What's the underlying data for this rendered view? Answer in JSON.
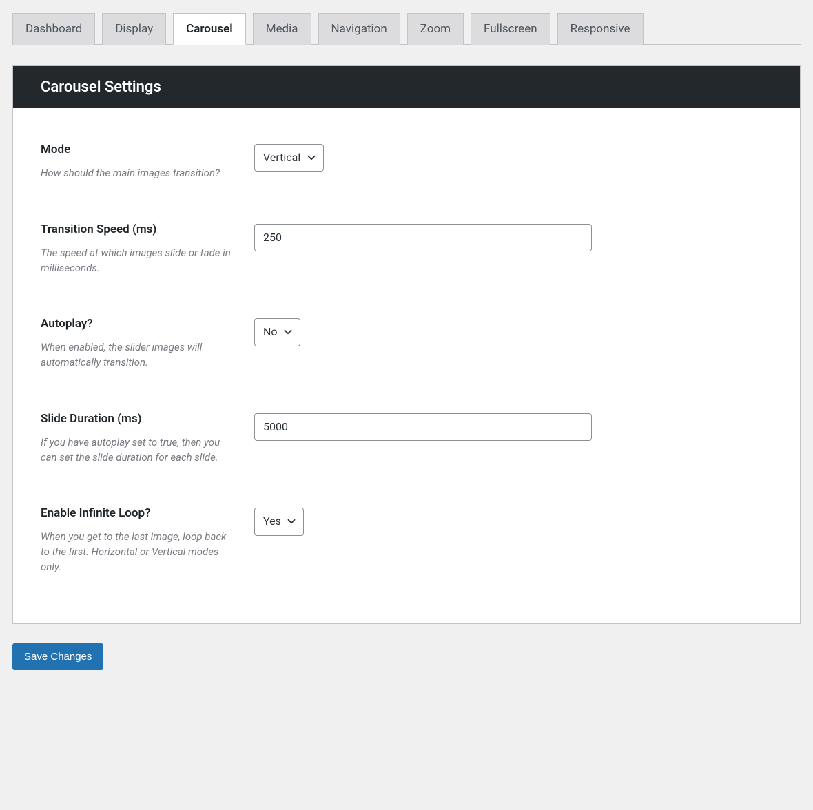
{
  "tabs": [
    {
      "label": "Dashboard",
      "active": false
    },
    {
      "label": "Display",
      "active": false
    },
    {
      "label": "Carousel",
      "active": true
    },
    {
      "label": "Media",
      "active": false
    },
    {
      "label": "Navigation",
      "active": false
    },
    {
      "label": "Zoom",
      "active": false
    },
    {
      "label": "Fullscreen",
      "active": false
    },
    {
      "label": "Responsive",
      "active": false
    }
  ],
  "panel": {
    "title": "Carousel Settings"
  },
  "fields": {
    "mode": {
      "label": "Mode",
      "help": "How should the main images transition?",
      "value": "Vertical"
    },
    "transition_speed": {
      "label": "Transition Speed (ms)",
      "help": "The speed at which images slide or fade in milliseconds.",
      "value": "250"
    },
    "autoplay": {
      "label": "Autoplay?",
      "help": "When enabled, the slider images will automatically transition.",
      "value": "No"
    },
    "slide_duration": {
      "label": "Slide Duration (ms)",
      "help": "If you have autoplay set to true, then you can set the slide duration for each slide.",
      "value": "5000"
    },
    "infinite_loop": {
      "label": "Enable Infinite Loop?",
      "help": "When you get to the last image, loop back to the first. Horizontal or Vertical modes only.",
      "value": "Yes"
    }
  },
  "buttons": {
    "save": "Save Changes"
  }
}
